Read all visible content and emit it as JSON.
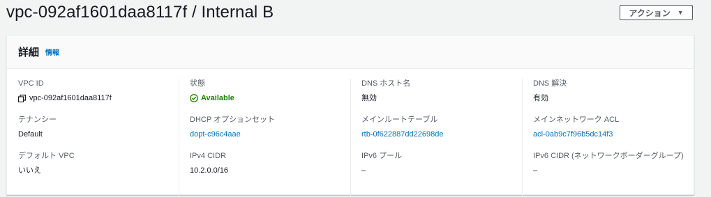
{
  "page": {
    "title": "vpc-092af1601daa8117f / Internal B",
    "actions_label": "アクション",
    "actions_caret": "▼"
  },
  "details": {
    "title": "詳細",
    "info_link": "情報",
    "columns": [
      [
        {
          "label": "VPC ID",
          "value": "vpc-092af1601daa8117f"
        },
        {
          "label": "テナンシー",
          "value": "Default"
        },
        {
          "label": "デフォルト VPC",
          "value": "いいえ"
        }
      ],
      [
        {
          "label": "状態",
          "value": "Available"
        },
        {
          "label": "DHCP オプションセット",
          "value": "dopt-c96c4aae"
        },
        {
          "label": "IPv4 CIDR",
          "value": "10.2.0.0/16"
        }
      ],
      [
        {
          "label": "DNS ホスト名",
          "value": "無効"
        },
        {
          "label": "メインルートテーブル",
          "value": "rtb-0f622887dd22698de"
        },
        {
          "label": "IPv6 プール",
          "value": "–"
        }
      ],
      [
        {
          "label": "DNS 解決",
          "value": "有効"
        },
        {
          "label": "メインネットワーク ACL",
          "value": "acl-0ab9c7f96b5dc14f3"
        },
        {
          "label": "IPv6 CIDR (ネットワークボーダーグループ)",
          "value": "–"
        }
      ]
    ]
  },
  "colors": {
    "link": "#0073bb",
    "success": "#1d8102",
    "label": "#545b64",
    "text": "#16191f"
  }
}
